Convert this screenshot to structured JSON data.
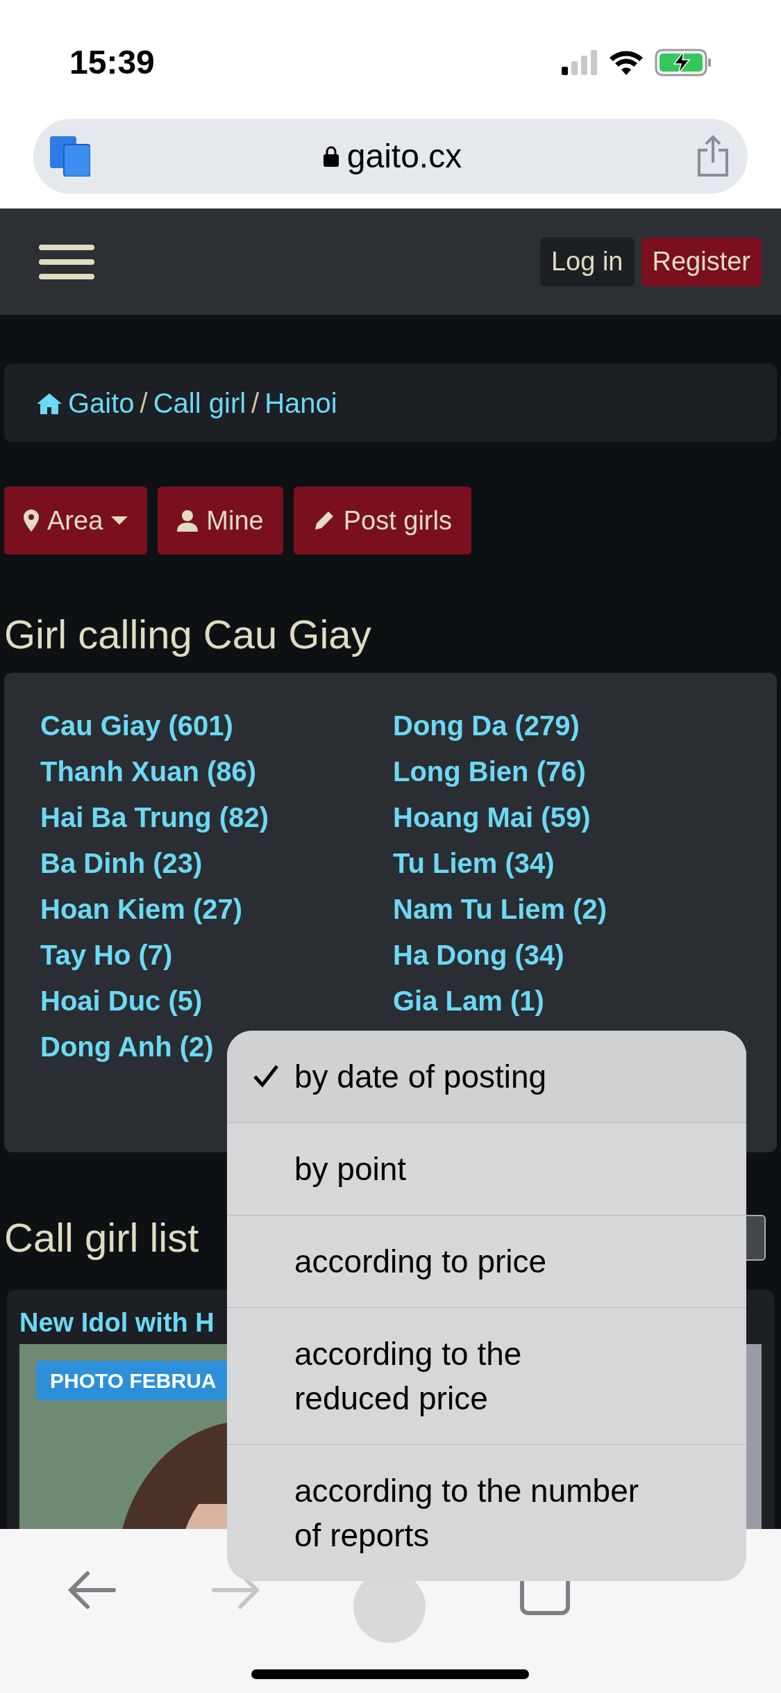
{
  "status_bar": {
    "time": "15:39"
  },
  "browser": {
    "url": "gaito.cx"
  },
  "nav": {
    "buttons": [
      {
        "label": "Log in",
        "kind": "dark"
      },
      {
        "label": "Register",
        "kind": "primary"
      }
    ]
  },
  "breadcrumb": [
    {
      "label": "Gaito"
    },
    {
      "separator": "/",
      "label": "Call girl"
    },
    {
      "separator": "/",
      "label": "Hanoi"
    }
  ],
  "actions": [
    {
      "label": "Area",
      "kind": "area",
      "dropdown": true
    },
    {
      "label": "Mine",
      "kind": "mine",
      "dropdown": false
    },
    {
      "label": "Post girls",
      "kind": "post",
      "dropdown": false
    }
  ],
  "area_title": "Girl calling Cau Giay",
  "areas": [
    "Cau Giay (601)",
    "Dong Da (279)",
    "Thanh Xuan (86)",
    "Long Bien (76)",
    "Hai Ba Trung (82)",
    "Hoang Mai (59)",
    "Ba Dinh (23)",
    "Tu Liem (34)",
    "Hoan Kiem (27)",
    "Nam Tu Liem (2)",
    "Tay Ho (7)",
    "Ha Dong (34)",
    "Hoai Duc (5)",
    "Gia Lam (1)",
    "Dong Anh (2)"
  ],
  "list_title": "Call girl list",
  "listing": {
    "title": "New Idol with H",
    "badge": "PHOTO FEBRUA"
  },
  "sort_menu": [
    {
      "lines": [
        "by date of posting"
      ],
      "selected": true
    },
    {
      "lines": [
        "by point"
      ],
      "selected": false
    },
    {
      "lines": [
        "according to price"
      ],
      "selected": false
    },
    {
      "lines": [
        "according to the",
        "reduced price"
      ],
      "selected": false
    },
    {
      "lines": [
        "according to the number",
        "of reports"
      ],
      "selected": false
    }
  ]
}
